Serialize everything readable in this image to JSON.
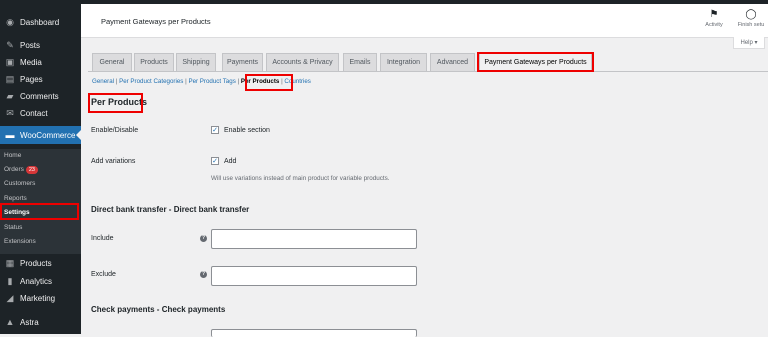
{
  "sidebar": {
    "items": [
      {
        "label": "Dashboard",
        "icon": "dashboard-icon"
      },
      {
        "label": "Posts",
        "icon": "pin-icon"
      },
      {
        "label": "Media",
        "icon": "media-icon"
      },
      {
        "label": "Pages",
        "icon": "pages-icon"
      },
      {
        "label": "Comments",
        "icon": "comments-icon"
      },
      {
        "label": "Contact",
        "icon": "mail-icon"
      },
      {
        "label": "WooCommerce",
        "icon": "woo-icon"
      },
      {
        "label": "Products",
        "icon": "products-icon"
      },
      {
        "label": "Analytics",
        "icon": "analytics-icon"
      },
      {
        "label": "Marketing",
        "icon": "megaphone-icon"
      },
      {
        "label": "Astra",
        "icon": "astra-icon"
      }
    ],
    "submenu": {
      "home": "Home",
      "orders": "Orders",
      "orders_badge": "23",
      "customers": "Customers",
      "reports": "Reports",
      "settings": "Settings",
      "status": "Status",
      "extensions": "Extensions"
    }
  },
  "header": {
    "title": "Payment Gateways per Products",
    "activity": "Activity",
    "finish_setup": "Finish setu",
    "help": "Help ▾"
  },
  "tabs": [
    "General",
    "Products",
    "Shipping",
    "Payments",
    "Accounts & Privacy",
    "Emails",
    "Integration",
    "Advanced",
    "Payment Gateways per Products"
  ],
  "active_tab": "Payment Gateways per Products",
  "sections": {
    "general": "General",
    "per_product_categories": "Per Product Categories",
    "per_product_tags": "Per Product Tags",
    "per_products": "Per Products",
    "countries": "Countries",
    "sep": " | "
  },
  "main": {
    "title": "Per Products",
    "enable_label": "Enable/Disable",
    "enable_checkbox": "Enable section",
    "variations_label": "Add variations",
    "variations_checkbox": "Add",
    "variations_desc": "Will use variations instead of main product for variable products.",
    "bank_title": "Direct bank transfer - Direct bank transfer",
    "include_label": "Include",
    "exclude_label": "Exclude",
    "check_title": "Check payments - Check payments",
    "help_tip": "?"
  },
  "colors": {
    "sidebar_bg": "#1d2327",
    "accent": "#2271b1",
    "highlight_box": "#e00000"
  }
}
